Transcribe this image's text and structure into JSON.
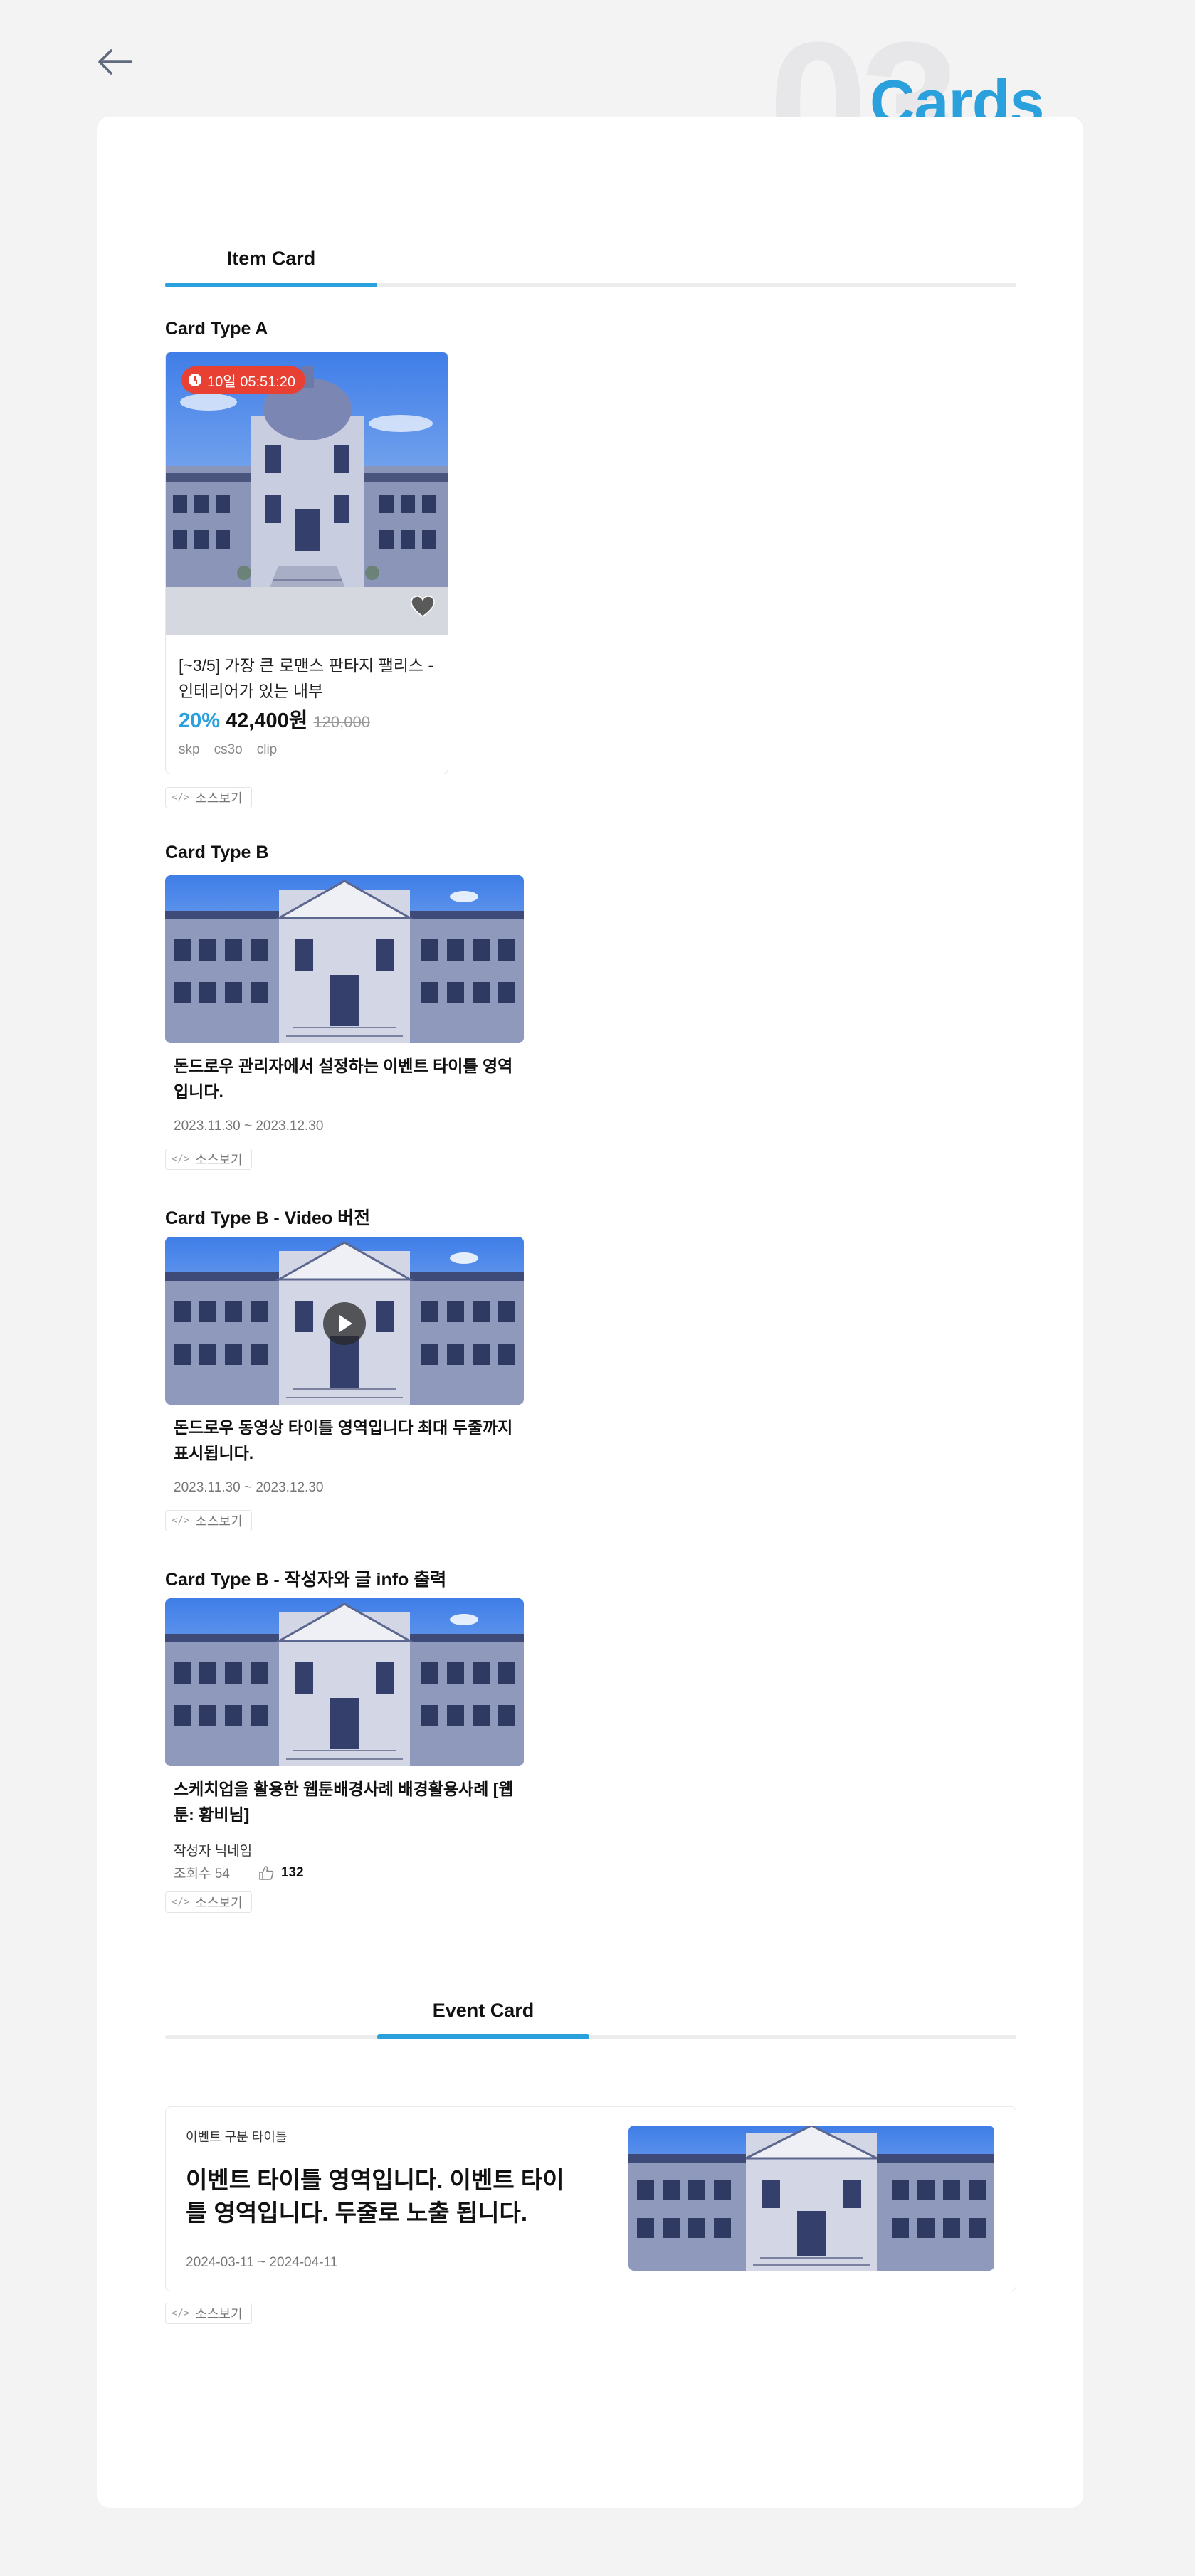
{
  "header": {
    "back_icon": "arrow-left-icon",
    "section_number": "03",
    "title": "Cards"
  },
  "item_tabs": {
    "active": "Item Card"
  },
  "card_type_a": {
    "label": "Card Type A",
    "timer": "10일 05:51:20",
    "title": "[~3/5] 가장 큰 로맨스 판타지 팰리스 - 인테리어가 있는 내부",
    "discount": "20%",
    "price": "42,400원",
    "original_price": "120,000",
    "tags": [
      "skp",
      "cs3o",
      "clip"
    ],
    "source_label": "소스보기"
  },
  "card_type_b": {
    "label": "Card Type B",
    "title": "돈드로우 관리자에서 설정하는 이벤트 타이틀 영역입니다.",
    "date": "2023.11.30 ~ 2023.12.30",
    "source_label": "소스보기"
  },
  "card_type_b_video": {
    "label": "Card Type B - Video 버전",
    "title": "돈드로우 동영상 타이틀 영역입니다 최대 두줄까지 표시됩니다.",
    "date": "2023.11.30 ~ 2023.12.30",
    "source_label": "소스보기"
  },
  "card_type_b_author": {
    "label": "Card Type B - 작성자와 글 info 출력",
    "title": "스케치업을 활용한 웹툰배경사례 배경활용사례 [웹툰: 황비님]",
    "author": "작성자 닉네임",
    "views": "조회수 54",
    "likes": "132",
    "source_label": "소스보기"
  },
  "event_tabs": {
    "active": "Event Card"
  },
  "event_card": {
    "category": "이벤트 구분 타이틀",
    "title": "이벤트 타이틀 영역입니다. 이벤트 타이틀 영역입니다. 두줄로 노출 됩니다.",
    "date": "2024-03-11 ~ 2024-04-11",
    "source_label": "소스보기"
  },
  "colors": {
    "accent": "#2aa0dc",
    "badge": "#e84032",
    "background": "#f3f3f4"
  }
}
